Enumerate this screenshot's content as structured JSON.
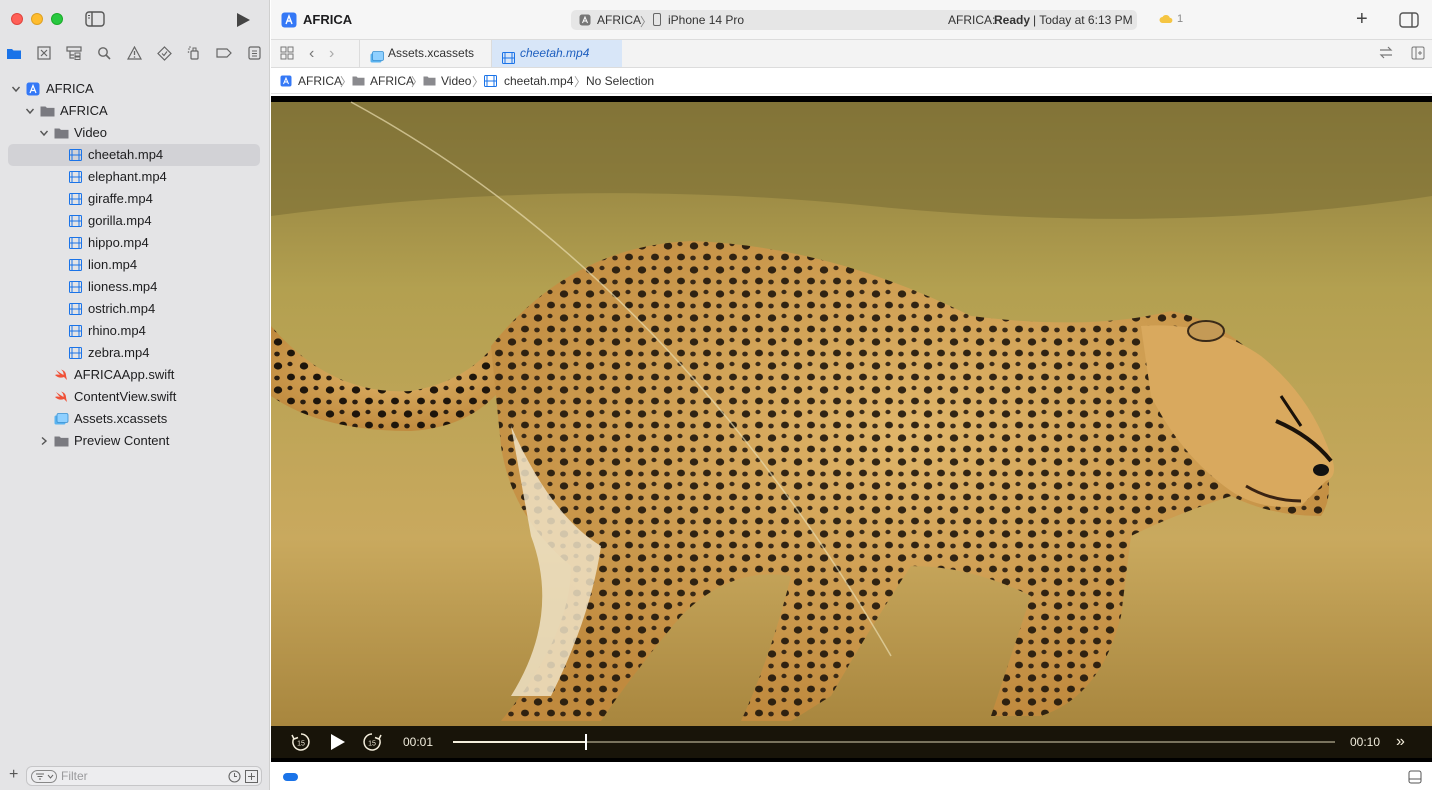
{
  "window": {
    "title": "AFRICA"
  },
  "scheme": {
    "project": "AFRICA",
    "device": "iPhone 14 Pro",
    "status_project": "AFRICA:",
    "status_state": "Ready",
    "status_time": "| Today at 6:13 PM"
  },
  "cloud": {
    "count": "1"
  },
  "tabs": [
    {
      "label": "Assets.xcassets",
      "icon": "xcassets-icon"
    },
    {
      "label": "cheetah.mp4",
      "icon": "video-file-icon",
      "active": true
    }
  ],
  "jumpbar": [
    "AFRICA",
    "AFRICA",
    "Video",
    "cheetah.mp4",
    "No Selection"
  ],
  "navigator": {
    "items": [
      {
        "label": "AFRICA",
        "icon": "xcode-project-icon",
        "level": 0,
        "expanded": true
      },
      {
        "label": "AFRICA",
        "icon": "folder-icon",
        "level": 1,
        "expanded": true
      },
      {
        "label": "Video",
        "icon": "folder-icon",
        "level": 2,
        "expanded": true
      },
      {
        "label": "cheetah.mp4",
        "icon": "video-file-icon",
        "level": 3,
        "selected": true
      },
      {
        "label": "elephant.mp4",
        "icon": "video-file-icon",
        "level": 3
      },
      {
        "label": "giraffe.mp4",
        "icon": "video-file-icon",
        "level": 3
      },
      {
        "label": "gorilla.mp4",
        "icon": "video-file-icon",
        "level": 3
      },
      {
        "label": "hippo.mp4",
        "icon": "video-file-icon",
        "level": 3
      },
      {
        "label": "lion.mp4",
        "icon": "video-file-icon",
        "level": 3
      },
      {
        "label": "lioness.mp4",
        "icon": "video-file-icon",
        "level": 3
      },
      {
        "label": "ostrich.mp4",
        "icon": "video-file-icon",
        "level": 3
      },
      {
        "label": "rhino.mp4",
        "icon": "video-file-icon",
        "level": 3
      },
      {
        "label": "zebra.mp4",
        "icon": "video-file-icon",
        "level": 3
      },
      {
        "label": "AFRICAApp.swift",
        "icon": "swift-file-icon",
        "level": 2
      },
      {
        "label": "ContentView.swift",
        "icon": "swift-file-icon",
        "level": 2
      },
      {
        "label": "Assets.xcassets",
        "icon": "xcassets-icon",
        "level": 2
      },
      {
        "label": "Preview Content",
        "icon": "folder-icon",
        "level": 2,
        "expanded": false
      }
    ],
    "filter_placeholder": "Filter"
  },
  "player": {
    "current_time": "00:01",
    "end_time": "00:10",
    "progress": 0.15,
    "skip_seconds": "15"
  },
  "colors": {
    "accent": "#1a73e8",
    "swift": "#f05138",
    "folder": "#7a7a80"
  }
}
